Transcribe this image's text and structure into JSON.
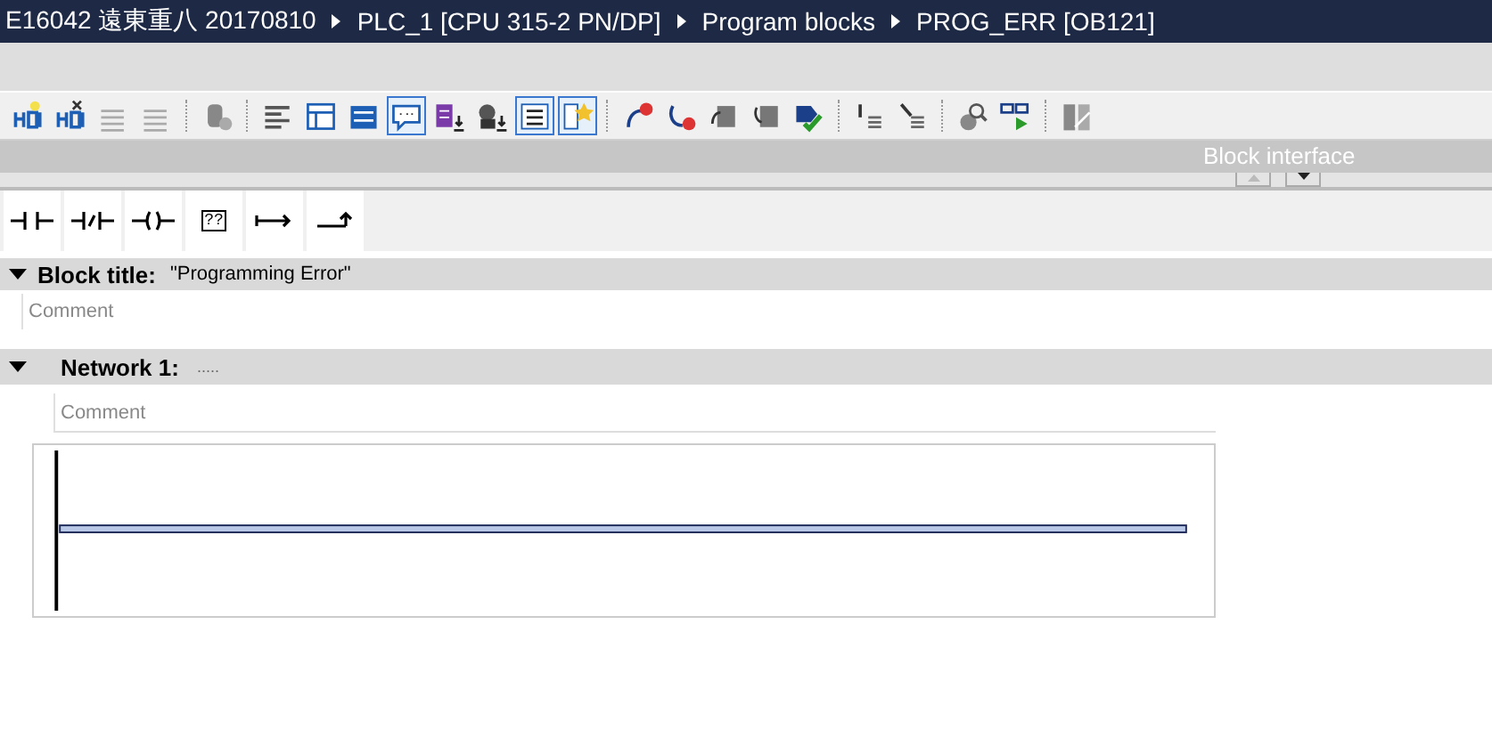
{
  "breadcrumb": [
    "E16042 遠東重八 20170810",
    "PLC_1 [CPU 315-2 PN/DP]",
    "Program blocks",
    "PROG_ERR [OB121]"
  ],
  "toolbar_groups": [
    [
      {
        "selected": false
      },
      {
        "selected": false
      },
      {
        "selected": false
      },
      {
        "selected": false
      }
    ],
    [
      {
        "selected": false
      }
    ],
    [
      {
        "selected": false
      },
      {
        "selected": false
      },
      {
        "selected": false
      },
      {
        "selected": true
      },
      {
        "selected": false
      },
      {
        "selected": false
      },
      {
        "selected": true
      },
      {
        "selected": true
      }
    ],
    [
      {
        "selected": false
      },
      {
        "selected": false
      },
      {
        "selected": false
      },
      {
        "selected": false
      },
      {
        "selected": false
      }
    ],
    [
      {
        "selected": false
      },
      {
        "selected": false
      }
    ],
    [
      {
        "selected": false
      },
      {
        "selected": false
      }
    ],
    [
      {
        "selected": false
      }
    ]
  ],
  "panel_header": {
    "title": "Block interface"
  },
  "lad_elements": [
    {
      "kind": "contact"
    },
    {
      "kind": "negated_contact"
    },
    {
      "kind": "coil"
    },
    {
      "kind": "empty_box",
      "label": "??"
    },
    {
      "kind": "open_branch"
    },
    {
      "kind": "close_branch"
    }
  ],
  "block_title": {
    "label": "Block title:",
    "value": "\"Programming Error\"",
    "expanded": true,
    "comment_placeholder": "Comment"
  },
  "networks": [
    {
      "label": "Network 1:",
      "title": ".....",
      "expanded": true,
      "comment_placeholder": "Comment"
    }
  ]
}
